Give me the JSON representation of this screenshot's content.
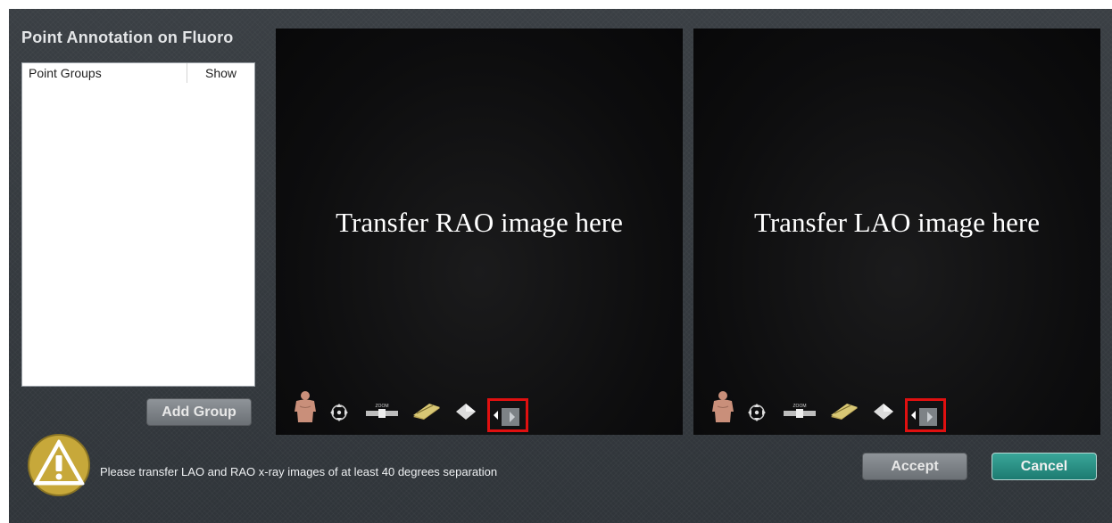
{
  "dialog": {
    "title": "Point Annotation on Fluoro"
  },
  "point_groups": {
    "columns": [
      "Point Groups",
      "Show"
    ],
    "rows": [],
    "add_button": "Add Group"
  },
  "viewports": {
    "rao": {
      "label": "Transfer RAO image here"
    },
    "lao": {
      "label": "Transfer LAO image here"
    }
  },
  "toolbar_icons": [
    "body-orientation-icon",
    "pan-icon",
    "zoom-icon",
    "film-stack-icon",
    "diamond-icon",
    "switch-view-icon"
  ],
  "toolbar": {
    "zoom_label": "ZOOM"
  },
  "status": {
    "message": "Please transfer LAO and RAO x-ray images of at least 40 degrees separation",
    "icon": "warning-icon"
  },
  "actions": {
    "accept": "Accept",
    "cancel": "Cancel"
  },
  "colors": {
    "background": "#34393e",
    "viewport": "#0d0d0e",
    "cancel_accent": "#2a9184",
    "highlight": "#e01010",
    "warning_fill": "#c7a83a"
  }
}
